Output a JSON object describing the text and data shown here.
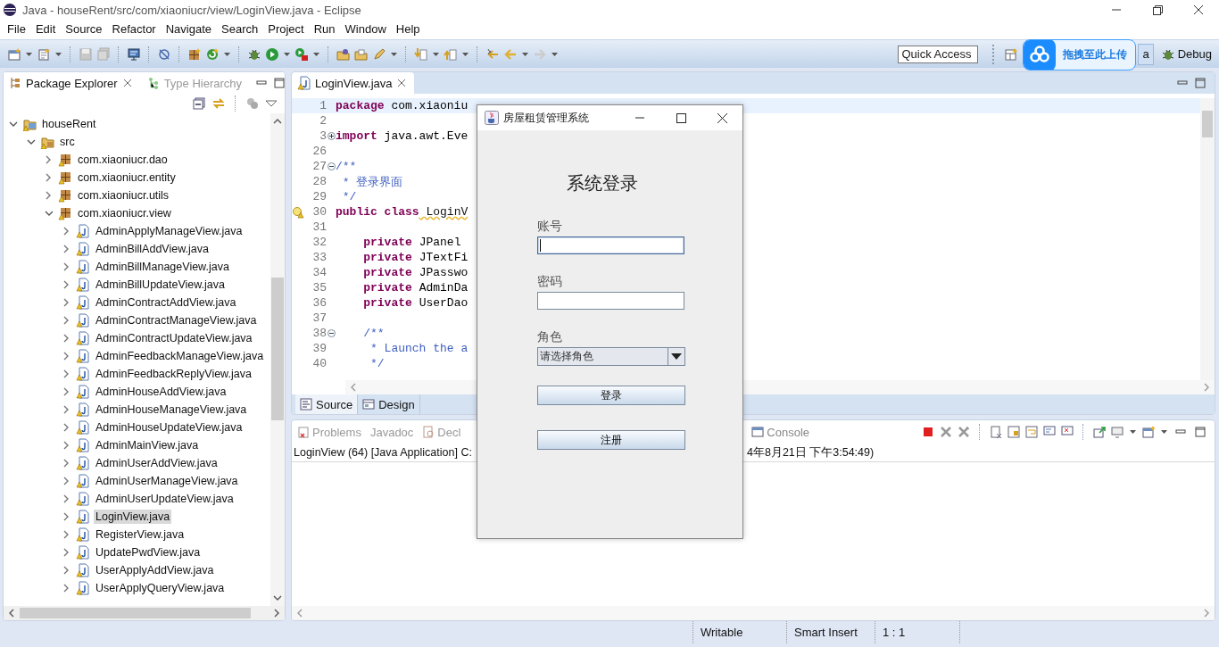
{
  "window": {
    "title": "Java - houseRent/src/com/xiaoniucr/view/LoginView.java - Eclipse"
  },
  "menu": [
    "File",
    "Edit",
    "Source",
    "Refactor",
    "Navigate",
    "Search",
    "Project",
    "Run",
    "Window",
    "Help"
  ],
  "toolbar": {
    "quick_access": {
      "placeholder": "Quick Access"
    },
    "perspectives": [
      {
        "label": "a",
        "selected": true
      },
      {
        "label": "Debug",
        "selected": false
      }
    ]
  },
  "upload_popup": {
    "label": "拖拽至此上传"
  },
  "explorer": {
    "tabs": [
      {
        "label": "Package Explorer",
        "selected": true
      },
      {
        "label": "Type Hierarchy",
        "selected": false
      }
    ],
    "tree": [
      {
        "label": "houseRent",
        "kind": "project",
        "expanded": true,
        "selected": false,
        "children": [
          {
            "label": "src",
            "kind": "folder",
            "expanded": true,
            "selected": false,
            "children": [
              {
                "label": "com.xiaoniucr.dao",
                "kind": "package",
                "expanded": false,
                "selected": false
              },
              {
                "label": "com.xiaoniucr.entity",
                "kind": "package",
                "expanded": false,
                "selected": false
              },
              {
                "label": "com.xiaoniucr.utils",
                "kind": "package",
                "expanded": false,
                "selected": false
              },
              {
                "label": "com.xiaoniucr.view",
                "kind": "package",
                "expanded": true,
                "selected": false,
                "children": [
                  {
                    "label": "AdminApplyManageView.java",
                    "kind": "file",
                    "expanded": false,
                    "selected": false
                  },
                  {
                    "label": "AdminBillAddView.java",
                    "kind": "file",
                    "expanded": false,
                    "selected": false
                  },
                  {
                    "label": "AdminBillManageView.java",
                    "kind": "file",
                    "expanded": false,
                    "selected": false
                  },
                  {
                    "label": "AdminBillUpdateView.java",
                    "kind": "file",
                    "expanded": false,
                    "selected": false
                  },
                  {
                    "label": "AdminContractAddView.java",
                    "kind": "file",
                    "expanded": false,
                    "selected": false
                  },
                  {
                    "label": "AdminContractManageView.java",
                    "kind": "file",
                    "expanded": false,
                    "selected": false
                  },
                  {
                    "label": "AdminContractUpdateView.java",
                    "kind": "file",
                    "expanded": false,
                    "selected": false
                  },
                  {
                    "label": "AdminFeedbackManageView.java",
                    "kind": "file",
                    "expanded": false,
                    "selected": false
                  },
                  {
                    "label": "AdminFeedbackReplyView.java",
                    "kind": "file",
                    "expanded": false,
                    "selected": false
                  },
                  {
                    "label": "AdminHouseAddView.java",
                    "kind": "file",
                    "expanded": false,
                    "selected": false
                  },
                  {
                    "label": "AdminHouseManageView.java",
                    "kind": "file",
                    "expanded": false,
                    "selected": false
                  },
                  {
                    "label": "AdminHouseUpdateView.java",
                    "kind": "file",
                    "expanded": false,
                    "selected": false
                  },
                  {
                    "label": "AdminMainView.java",
                    "kind": "file",
                    "expanded": false,
                    "selected": false
                  },
                  {
                    "label": "AdminUserAddView.java",
                    "kind": "file",
                    "expanded": false,
                    "selected": false
                  },
                  {
                    "label": "AdminUserManageView.java",
                    "kind": "file",
                    "expanded": false,
                    "selected": false
                  },
                  {
                    "label": "AdminUserUpdateView.java",
                    "kind": "file",
                    "expanded": false,
                    "selected": false
                  },
                  {
                    "label": "LoginView.java",
                    "kind": "file",
                    "expanded": false,
                    "selected": true
                  },
                  {
                    "label": "RegisterView.java",
                    "kind": "file",
                    "expanded": false,
                    "selected": false
                  },
                  {
                    "label": "UpdatePwdView.java",
                    "kind": "file",
                    "expanded": false,
                    "selected": false
                  },
                  {
                    "label": "UserApplyAddView.java",
                    "kind": "file",
                    "expanded": false,
                    "selected": false
                  },
                  {
                    "label": "UserApplyQueryView.java",
                    "kind": "file",
                    "expanded": false,
                    "selected": false
                  }
                ]
              }
            ]
          }
        ]
      }
    ]
  },
  "editor": {
    "tabs": [
      {
        "label": "LoginView.java",
        "selected": true
      }
    ],
    "lines": [
      {
        "number": "1",
        "current": true,
        "tokens": [
          {
            "kind": "keyword",
            "text": "package"
          },
          {
            "kind": "plain",
            "text": " com.xiaoniu"
          }
        ]
      },
      {
        "number": "2",
        "current": false
      },
      {
        "number": "3",
        "current": false,
        "collapsed": true,
        "tokens": [
          {
            "kind": "keyword",
            "text": "import"
          },
          {
            "kind": "plain",
            "text": " java.awt.Eve"
          }
        ]
      },
      {
        "number": "26",
        "current": false
      },
      {
        "number": "27",
        "current": false,
        "collapsed": false,
        "tokens": [
          {
            "kind": "comment",
            "text": "/**"
          }
        ]
      },
      {
        "number": "28",
        "current": false,
        "tokens": [
          {
            "kind": "comment",
            "text": " * 登录界面"
          }
        ]
      },
      {
        "number": "29",
        "current": false,
        "tokens": [
          {
            "kind": "comment",
            "text": " */"
          }
        ]
      },
      {
        "number": "30",
        "current": false,
        "warning": true,
        "tokens": [
          {
            "kind": "keyword",
            "text": "public class"
          },
          {
            "kind": "squiggle",
            "text": " LoginV"
          }
        ]
      },
      {
        "number": "31",
        "current": false
      },
      {
        "number": "32",
        "current": false,
        "tokens": [
          {
            "kind": "keyword",
            "text": "    private"
          },
          {
            "kind": "plain",
            "text": " JPanel"
          }
        ]
      },
      {
        "number": "33",
        "current": false,
        "tokens": [
          {
            "kind": "keyword",
            "text": "    private"
          },
          {
            "kind": "plain",
            "text": " JTextFi"
          }
        ]
      },
      {
        "number": "34",
        "current": false,
        "tokens": [
          {
            "kind": "keyword",
            "text": "    private"
          },
          {
            "kind": "plain",
            "text": " JPasswo"
          }
        ]
      },
      {
        "number": "35",
        "current": false,
        "tokens": [
          {
            "kind": "keyword",
            "text": "    private"
          },
          {
            "kind": "plain",
            "text": " AdminDa"
          }
        ]
      },
      {
        "number": "36",
        "current": false,
        "tokens": [
          {
            "kind": "keyword",
            "text": "    private"
          },
          {
            "kind": "plain",
            "text": " UserDao"
          }
        ]
      },
      {
        "number": "37",
        "current": false
      },
      {
        "number": "38",
        "current": false,
        "collapsed": false,
        "tokens": [
          {
            "kind": "comment",
            "text": "    /**"
          }
        ]
      },
      {
        "number": "39",
        "current": false,
        "tokens": [
          {
            "kind": "comment",
            "text": "     * Launch the a"
          }
        ]
      },
      {
        "number": "40",
        "current": false,
        "tokens": [
          {
            "kind": "comment",
            "text": "     */"
          }
        ]
      }
    ],
    "mode_tabs": [
      {
        "label": "Source",
        "selected": true
      },
      {
        "label": "Design",
        "selected": false
      }
    ]
  },
  "console": {
    "tabs": [
      {
        "label": "Problems",
        "selected": false
      },
      {
        "label": "Javadoc",
        "selected": false
      },
      {
        "label": "Decl",
        "selected": false
      },
      {
        "label": "Console",
        "selected": true
      }
    ],
    "text_start": "LoginView (64) [Java Application] C:",
    "text_end": "4年8月21日 下午3:54:49)"
  },
  "status_bar": {
    "mode": "Writable",
    "insert": "Smart Insert",
    "position": "1 : 1"
  },
  "dialog": {
    "title": "房屋租赁管理系统",
    "heading": "系统登录",
    "fields": [
      {
        "kind": "text",
        "label": "账号",
        "focused": true
      },
      {
        "kind": "password",
        "label": "密码",
        "focused": false
      },
      {
        "kind": "select",
        "label": "角色",
        "value": "请选择角色"
      }
    ],
    "buttons": [
      "登录",
      "注册"
    ]
  }
}
